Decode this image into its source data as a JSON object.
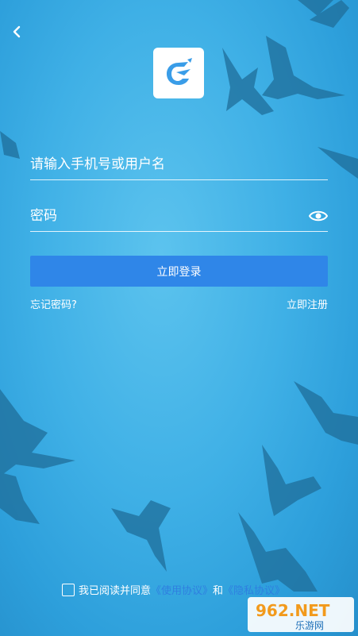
{
  "header": {
    "back_icon": "chevron-left-icon"
  },
  "logo": {
    "icon": "app-logo-icon",
    "color": "#3a9de8"
  },
  "form": {
    "username_placeholder": "请输入手机号或用户名",
    "password_placeholder": "密码",
    "eye_icon": "eye-icon",
    "login_label": "立即登录",
    "forgot_label": "忘记密码?",
    "register_label": "立即注册"
  },
  "agreement": {
    "prefix": "我已阅读并同意",
    "usage_link": "《使用协议》",
    "and": "和",
    "privacy_link": "《隐私协议》"
  },
  "watermark": {
    "main": "962.NET",
    "sub": "乐游网"
  },
  "colors": {
    "primary_button": "#2f86e8",
    "link": "#2f7fe0",
    "background": "#3fb0e6"
  }
}
